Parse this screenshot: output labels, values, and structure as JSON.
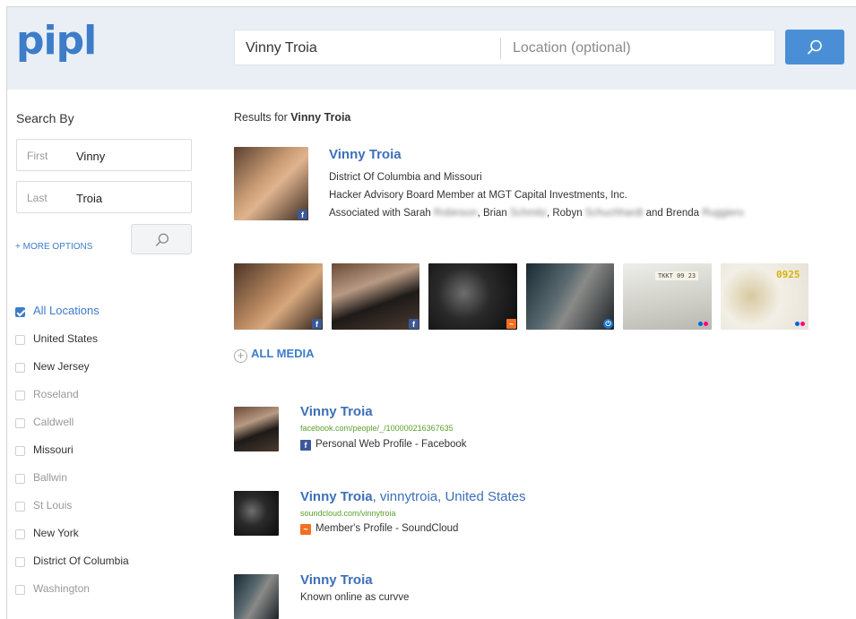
{
  "app": {
    "logo": "pipl",
    "brand_color": "#3d7cc9"
  },
  "search": {
    "name_value": "Vinny Troia",
    "location_placeholder": "Location (optional)",
    "button_icon": "search-icon"
  },
  "sidebar": {
    "title": "Search By",
    "first_label": "First",
    "first_value": "Vinny",
    "last_label": "Last",
    "last_value": "Troia",
    "more_options": "+ MORE OPTIONS",
    "locations": [
      {
        "label": "All Locations",
        "checked": true
      },
      {
        "label": "United States",
        "checked": false
      },
      {
        "label": "New Jersey",
        "checked": false
      },
      {
        "label": "Roseland",
        "checked": false
      },
      {
        "label": "Caldwell",
        "checked": false
      },
      {
        "label": "Missouri",
        "checked": false
      },
      {
        "label": "Ballwin",
        "checked": false
      },
      {
        "label": "St Louis",
        "checked": false
      },
      {
        "label": "New York",
        "checked": false
      },
      {
        "label": "District Of Columbia",
        "checked": false
      },
      {
        "label": "Washington",
        "checked": false
      }
    ]
  },
  "results": {
    "prefix": "Results for",
    "query": "Vinny Troia",
    "top": {
      "name": "Vinny Troia",
      "location": "District Of Columbia and Missouri",
      "job": "Hacker Advisory Board Member at MGT Capital Investments, Inc.",
      "assoc_prefix": "Associated with Sarah",
      "assoc_blur1": "Robinson",
      "assoc_mid1": ", Brian",
      "assoc_blur2": "Schmitz",
      "assoc_mid2": ", Robyn",
      "assoc_blur3": "Schuchhardt",
      "assoc_mid3": "and Brenda",
      "assoc_blur4": "Ruggiero",
      "badge": "f"
    },
    "media": [
      {
        "source": "facebook",
        "badge": "f"
      },
      {
        "source": "facebook",
        "badge": "f"
      },
      {
        "source": "soundcloud",
        "badge": "sc"
      },
      {
        "source": "power",
        "badge": "pw"
      },
      {
        "source": "flickr",
        "badge": "fl",
        "text": "TKKT 09 23"
      },
      {
        "source": "flickr",
        "badge": "fl",
        "text": "0925"
      }
    ],
    "all_media": "ALL MEDIA",
    "items": [
      {
        "name": "Vinny Troia",
        "alias": "",
        "url": "facebook.com/people/_/100000216367635",
        "source_icon": "facebook-icon",
        "desc": "Personal Web Profile - Facebook"
      },
      {
        "name": "Vinny Troia",
        "alias": ", vinnytroia, United States",
        "url": "soundcloud.com/vinnytroia",
        "source_icon": "soundcloud-icon",
        "desc": "Member's Profile - SoundCloud"
      },
      {
        "name": "Vinny Troia",
        "alias": "",
        "url": "",
        "source_icon": "",
        "desc": "Known online as curvve"
      }
    ]
  }
}
